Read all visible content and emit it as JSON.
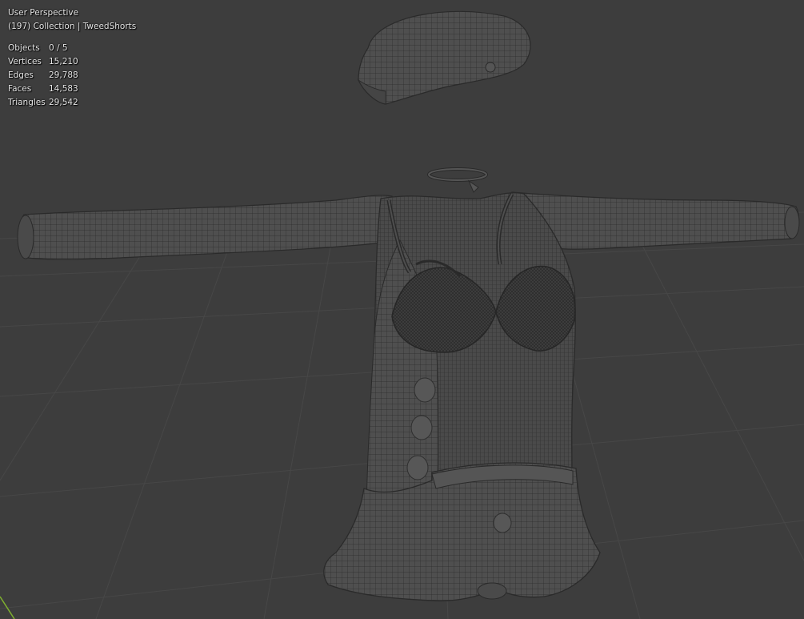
{
  "viewport": {
    "perspective_label": "User Perspective",
    "collection_label": "(197) Collection | TweedShorts",
    "background_color": "#3d3d3d",
    "grid_color": "#4a4a4a",
    "wire_color": "#2a2a2a",
    "mesh_fill": "#505050",
    "axis_color": "#7fb02f"
  },
  "stats": [
    {
      "label": "Objects",
      "value": "0 / 5"
    },
    {
      "label": "Vertices",
      "value": "15,210"
    },
    {
      "label": "Edges",
      "value": "29,788"
    },
    {
      "label": "Faces",
      "value": "14,583"
    },
    {
      "label": "Triangles",
      "value": "29,542"
    }
  ],
  "objects": [
    {
      "name": "beret-mesh-icon"
    },
    {
      "name": "choker-mesh-icon"
    },
    {
      "name": "jacket-mesh-icon"
    },
    {
      "name": "bra-mesh-icon"
    },
    {
      "name": "shorts-mesh-icon"
    }
  ]
}
